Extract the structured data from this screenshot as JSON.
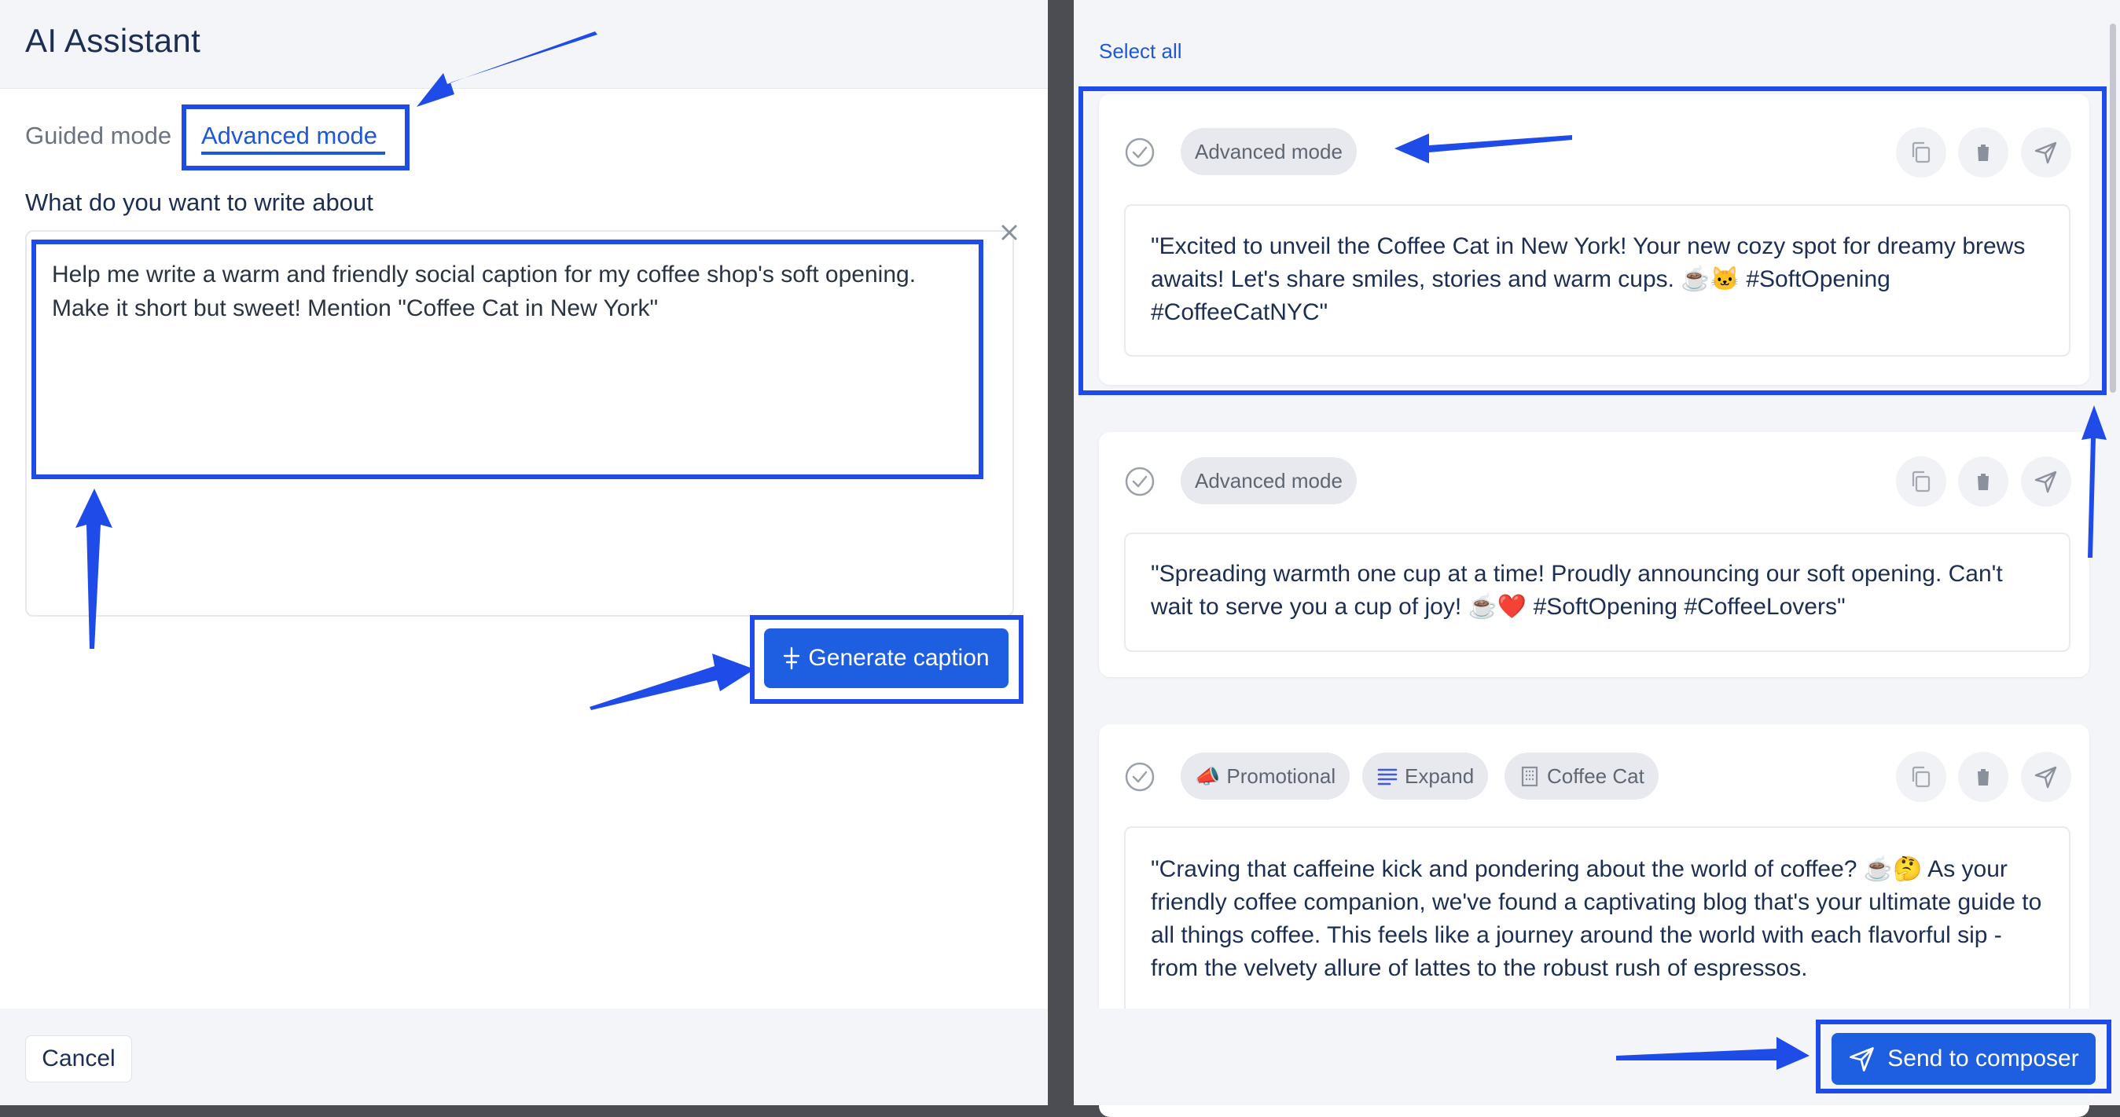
{
  "left": {
    "title": "AI Assistant",
    "tabs": [
      {
        "label": "Guided mode",
        "active": false
      },
      {
        "label": "Advanced mode",
        "active": true
      }
    ],
    "prompt_label": "What do you want to write about",
    "prompt_value": "Help me write a warm and friendly social caption for my coffee shop's soft opening.\nMake it short but sweet! Mention \"Coffee Cat in New York\"",
    "generate_label": "Generate caption",
    "cancel_label": "Cancel"
  },
  "right": {
    "select_all_label": "Select all",
    "cards": [
      {
        "tags": [
          "Advanced mode"
        ],
        "caption": "\"Excited to unveil the Coffee Cat in New York! Your new cozy spot for dreamy brews awaits! Let's share smiles, stories and warm cups. ☕🐱 #SoftOpening #CoffeeCatNYC\""
      },
      {
        "tags": [
          "Advanced mode"
        ],
        "caption": "\"Spreading warmth one cup at a time! Proudly announcing our soft opening. Can't wait to serve you a cup of joy! ☕❤️ #SoftOpening #CoffeeLovers\""
      },
      {
        "tags": [
          {
            "icon": "📣",
            "label": "Promotional"
          },
          {
            "icon": "lines-icon",
            "label": "Expand"
          },
          {
            "icon": "building-icon",
            "label": "Coffee Cat"
          }
        ],
        "caption": "\"Craving that caffeine kick and pondering about the world of coffee? ☕🤔 As your friendly coffee companion, we've found a captivating blog that's your ultimate guide to all things coffee. This feels like a journey around the world with each flavorful sip - from the velvety allure of lattes to the robust rush of espressos."
      }
    ],
    "send_label": "Send to composer"
  },
  "colors": {
    "accent": "#1d5fe0",
    "annotation": "#1f4be8",
    "panel_bg": "#f4f5f9",
    "divider": "#4b4d53"
  }
}
